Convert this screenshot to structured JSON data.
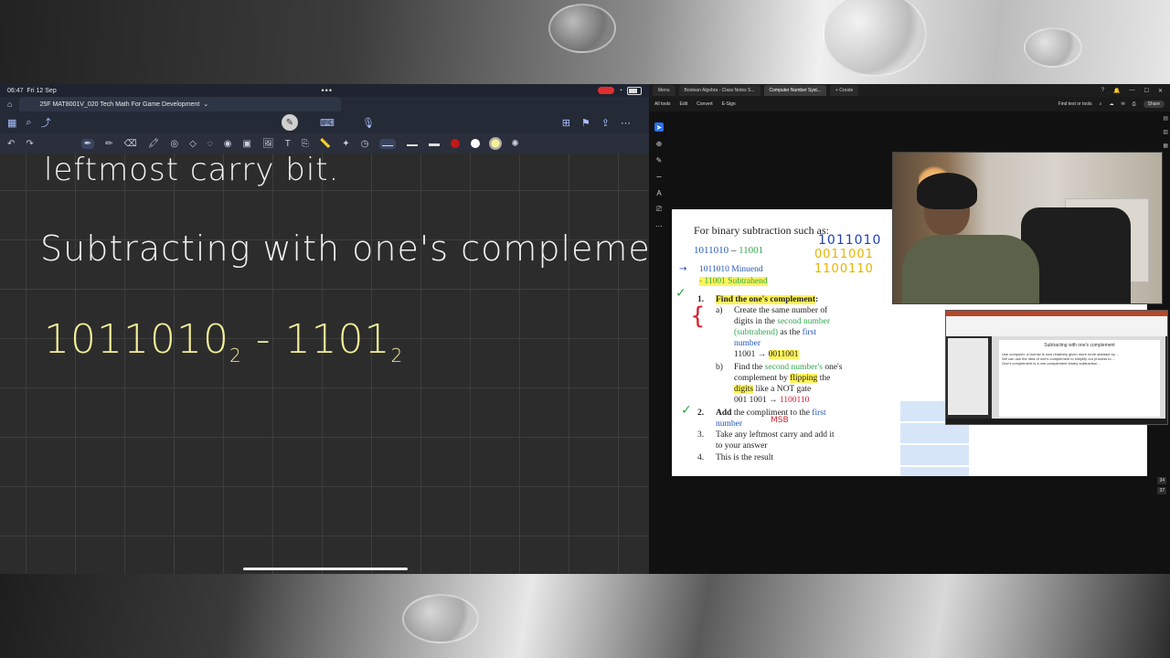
{
  "ipad": {
    "status": {
      "time": "06:47",
      "date": "Fri 12 Sep",
      "dots": "•••"
    },
    "tab": {
      "title": "25F MAT8001V_020 Tech Math For Game Development",
      "chevron": "⌄"
    },
    "canvas": {
      "line1": "leftmost carry bit.",
      "line2": "Subtracting with one's complement",
      "line3_a": "1011010",
      "line3_a_sub": "2",
      "line3_op": " - ",
      "line3_b": "1101",
      "line3_b_sub": "2"
    }
  },
  "browser": {
    "tabs": [
      {
        "label": "Menu"
      },
      {
        "label": "Boolean Algebra - Class Notes S..."
      },
      {
        "label": "Computer Number Syst..."
      },
      {
        "label": "+ Create"
      }
    ],
    "pdf_menu": [
      "All tools",
      "Edit",
      "Convert",
      "E-Sign"
    ],
    "find_label": "Find text or tools",
    "share_label": "Share",
    "page_numbers": [
      "34",
      "37"
    ]
  },
  "slide": {
    "heading": "For binary subtraction such as:",
    "example_a": "1011010",
    "example_dash": " – ",
    "example_b": "11001",
    "minuend": "1011010 Minuend",
    "subtrahend": "-  11001 Subtrahend",
    "step1_num": "1.",
    "step1": "Find the one's complement",
    "step1_colon": ":",
    "a_label": "a)",
    "a_line1": "Create the same number of",
    "a_line2_pre": "digits in the ",
    "a_line2_green": "second number",
    "a_line3_green": "(subtrahend)",
    "a_line3_post": " as the ",
    "a_line3_blue": "first",
    "a_line4_blue": "number",
    "a_line5_pre": "11001 → ",
    "a_line5_hl": "0011001",
    "b_label": "b)",
    "b_line1_pre": "Find the ",
    "b_line1_green": "second number's",
    "b_line1_post": " one's",
    "b_line2_pre": "complement by ",
    "b_line2_hl": "flipping",
    "b_line2_post": " the",
    "b_line3_hl": "digits",
    "b_line3_post": " like a NOT gate",
    "b_line4_pre": "001 1001 → ",
    "b_line4_red": "1100110",
    "step2_num": "2.",
    "step2_bold": "Add",
    "step2_post": " the compliment to the ",
    "step2_blue": "first",
    "step2_blue2": "number",
    "step3_num": "3.",
    "step3_line1": "Take any leftmost carry and add it",
    "step3_line2": "to your answer",
    "step4_num": "4.",
    "step4": "This is the result",
    "annot_row1": "1011010",
    "annot_row2": "0011001",
    "annot_row3": "1100110",
    "annot_msb": "MSB"
  },
  "ppt": {
    "slide_title": "Subtracting with one's complement",
    "bullets": [
      "Use computer: a borrow is now relatively given more more abstract by ...",
      "We can use the idea of one's complement to simplify our process to ...",
      "One's complement is a one-complement binary subtraction ..."
    ]
  },
  "colors": {
    "accent_blue": "#2356b8",
    "green": "#2ea84f",
    "highlight": "#fff35a",
    "red": "#d81e2b",
    "ink_yellow": "#f4f09a"
  }
}
